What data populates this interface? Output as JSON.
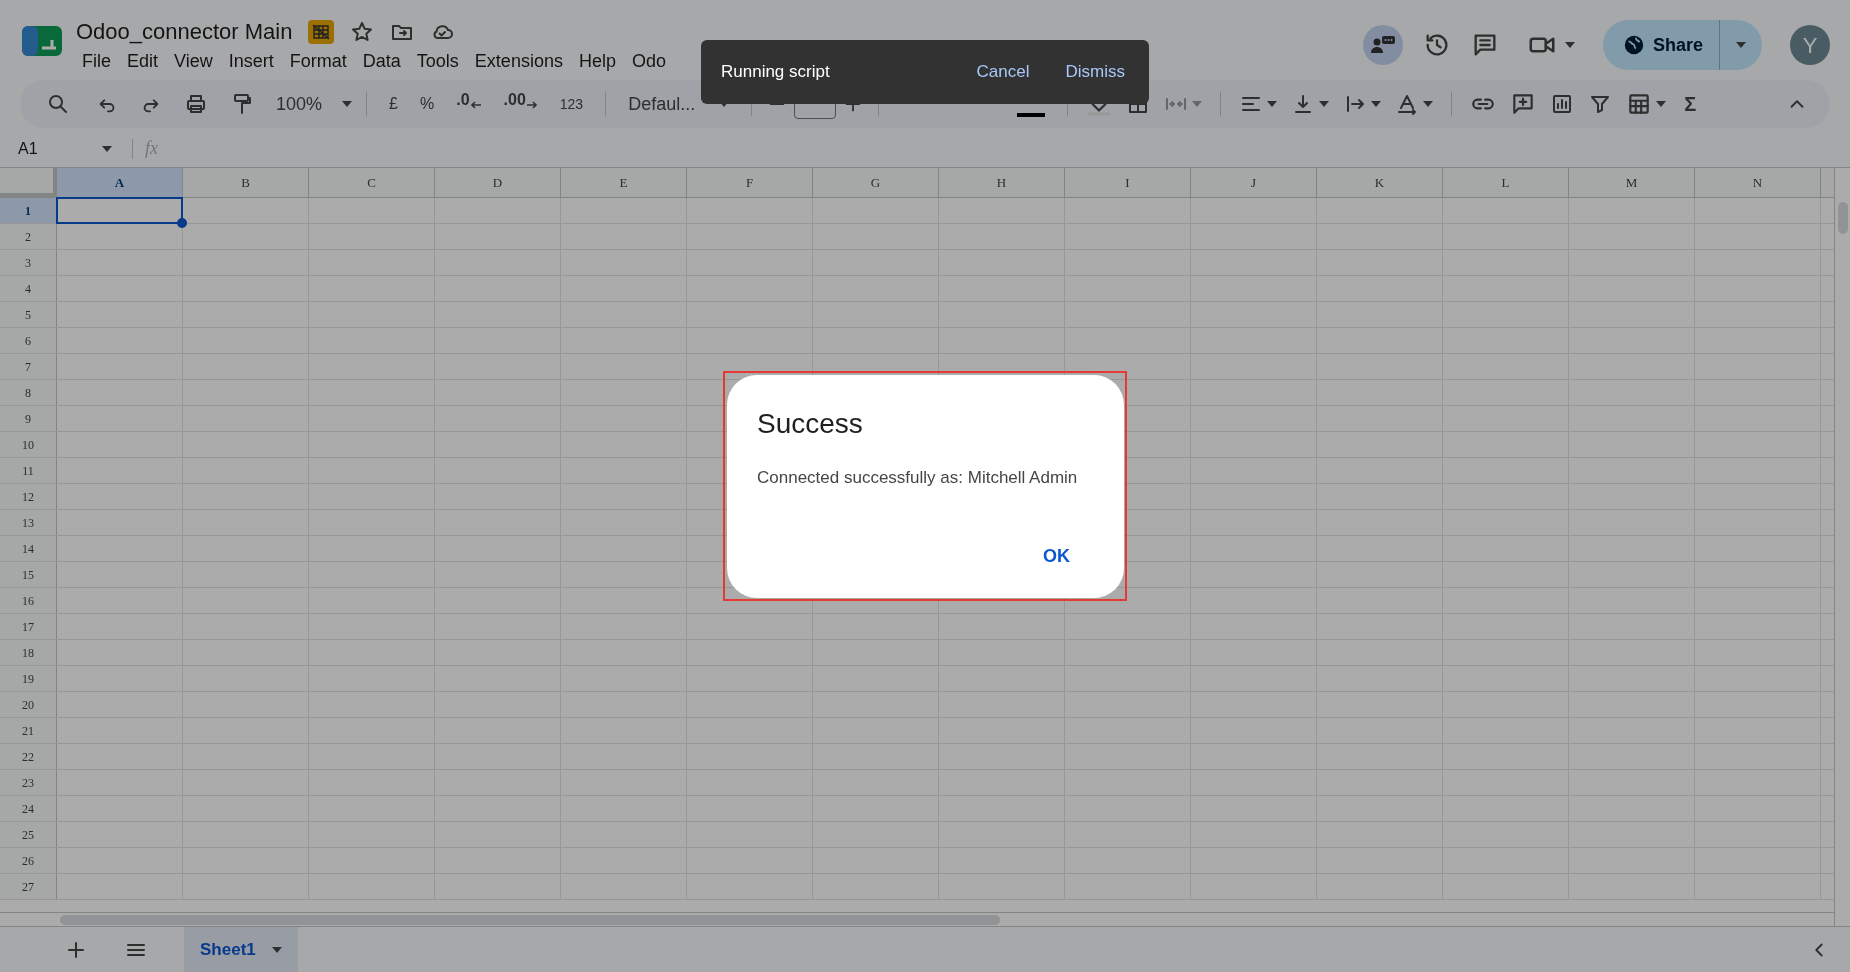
{
  "document": {
    "title": "Odoo_connector Main"
  },
  "menu": [
    {
      "label": "File"
    },
    {
      "label": "Edit"
    },
    {
      "label": "View"
    },
    {
      "label": "Insert"
    },
    {
      "label": "Format"
    },
    {
      "label": "Data"
    },
    {
      "label": "Tools"
    },
    {
      "label": "Extensions"
    },
    {
      "label": "Help"
    },
    {
      "label": "Odo"
    }
  ],
  "toolbar": {
    "zoom": "100%",
    "currency": "£",
    "percent": "%",
    "decrease_decimals": ".0",
    "increase_decimals": ".00",
    "number_format": "123",
    "font": "Defaul...",
    "functions": "Σ"
  },
  "share_button": {
    "label": "Share"
  },
  "avatar": {
    "initial": "Y"
  },
  "name_box": {
    "value": "A1"
  },
  "formula_bar": {
    "label": "fx"
  },
  "grid": {
    "columns": [
      {
        "label": "A",
        "selected": true
      },
      {
        "label": "B",
        "selected": false
      },
      {
        "label": "C",
        "selected": false
      },
      {
        "label": "D",
        "selected": false
      },
      {
        "label": "E",
        "selected": false
      },
      {
        "label": "F",
        "selected": false
      },
      {
        "label": "G",
        "selected": false
      },
      {
        "label": "H",
        "selected": false
      },
      {
        "label": "I",
        "selected": false
      },
      {
        "label": "J",
        "selected": false
      },
      {
        "label": "K",
        "selected": false
      },
      {
        "label": "L",
        "selected": false
      },
      {
        "label": "M",
        "selected": false
      },
      {
        "label": "N",
        "selected": false
      }
    ],
    "rows": [
      {
        "label": "1",
        "selected": true
      },
      {
        "label": "2",
        "selected": false
      },
      {
        "label": "3",
        "selected": false
      },
      {
        "label": "4",
        "selected": false
      },
      {
        "label": "5",
        "selected": false
      },
      {
        "label": "6",
        "selected": false
      },
      {
        "label": "7",
        "selected": false
      },
      {
        "label": "8",
        "selected": false
      },
      {
        "label": "9",
        "selected": false
      },
      {
        "label": "10",
        "selected": false
      },
      {
        "label": "11",
        "selected": false
      },
      {
        "label": "12",
        "selected": false
      },
      {
        "label": "13",
        "selected": false
      },
      {
        "label": "14",
        "selected": false
      },
      {
        "label": "15",
        "selected": false
      },
      {
        "label": "16",
        "selected": false
      },
      {
        "label": "17",
        "selected": false
      },
      {
        "label": "18",
        "selected": false
      },
      {
        "label": "19",
        "selected": false
      },
      {
        "label": "20",
        "selected": false
      },
      {
        "label": "21",
        "selected": false
      },
      {
        "label": "22",
        "selected": false
      },
      {
        "label": "23",
        "selected": false
      },
      {
        "label": "24",
        "selected": false
      },
      {
        "label": "25",
        "selected": false
      },
      {
        "label": "26",
        "selected": false
      },
      {
        "label": "27",
        "selected": false
      }
    ]
  },
  "sheets": [
    {
      "label": "Sheet1",
      "selected": true
    }
  ],
  "toast": {
    "message": "Running script",
    "actions": [
      "Cancel",
      "Dismiss"
    ]
  },
  "dialog": {
    "title": "Success",
    "message": "Connected successfully as: Mitchell Admin",
    "button": "OK"
  }
}
